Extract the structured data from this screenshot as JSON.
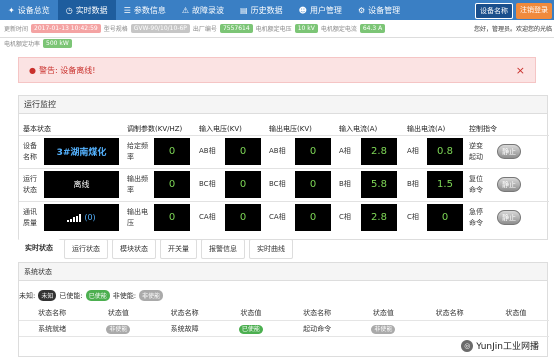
{
  "nav": {
    "tabs": [
      {
        "icon": "home-icon",
        "glyph": "✦",
        "label": "设备总览"
      },
      {
        "icon": "clock-icon",
        "glyph": "◷",
        "label": "实时数据"
      },
      {
        "icon": "list-icon",
        "glyph": "☰",
        "label": "参数信息"
      },
      {
        "icon": "warning-icon",
        "glyph": "⚠",
        "label": "故障录波"
      },
      {
        "icon": "file-icon",
        "glyph": "▤",
        "label": "历史数据"
      },
      {
        "icon": "user-icon",
        "glyph": "☻",
        "label": "用户管理"
      },
      {
        "icon": "gear-icon",
        "glyph": "⚙",
        "label": "设备管理"
      }
    ],
    "active_index": 1,
    "device_btn": "设备名称",
    "logout_btn": "注销登录"
  },
  "info": {
    "update_label": "更新时间",
    "update_value": "2017-01-13 10:42:59",
    "model_label": "型号规格",
    "model_value": "GVW-90/10/10-6P",
    "serial_label": "出厂编号",
    "serial_value": "7557614",
    "voltage_label": "电机额定电压",
    "voltage_value": "10 kV",
    "current_label": "电机额定电流",
    "current_value": "64.3 A",
    "power_label": "电机额定功率",
    "power_value": "500 kW",
    "welcome": "您好，管理员。欢迎您的光临"
  },
  "alert": {
    "text": "警告: 设备离线!"
  },
  "monitor": {
    "title": "运行监控",
    "headers": [
      "基本状态",
      "调制参数(KV/HZ)",
      "输入电压(KV)",
      "输出电压(KV)",
      "输入电流(A)",
      "输出电流(A)",
      "控制指令"
    ],
    "rows": [
      {
        "status_label": "设备\n名称",
        "status_value": "3#湖南煤化",
        "param_label": "给定频\n率",
        "param_value": "0",
        "in_v_label": "AB相",
        "in_v": "0",
        "out_v_label": "AB相",
        "out_v": "0",
        "in_a_label": "A相",
        "in_a": "2.8",
        "out_a_label": "A相",
        "out_a": "0.8",
        "cmd_label": "逆变\n起动",
        "cmd_btn": "静止"
      },
      {
        "status_label": "运行\n状态",
        "status_value": "离线",
        "param_label": "输出频\n率",
        "param_value": "0",
        "in_v_label": "BC相",
        "in_v": "0",
        "out_v_label": "BC相",
        "out_v": "0",
        "in_a_label": "B相",
        "in_a": "5.8",
        "out_a_label": "B相",
        "out_a": "1.5",
        "cmd_label": "复位\n命令",
        "cmd_btn": "静止"
      },
      {
        "status_label": "通讯\n质量",
        "status_value": "(0)",
        "param_label": "输出电\n压",
        "param_value": "0",
        "in_v_label": "CA相",
        "in_v": "0",
        "out_v_label": "CA相",
        "out_v": "0",
        "in_a_label": "C相",
        "in_a": "2.8",
        "out_a_label": "C相",
        "out_a": "0",
        "cmd_label": "急停\n命令",
        "cmd_btn": "静止"
      }
    ]
  },
  "tabs": [
    "实时状态",
    "运行状态",
    "模块状态",
    "开关量",
    "报警信息",
    "实时曲线"
  ],
  "system": {
    "title": "系统状态",
    "legend": {
      "unknown_label": "未知:",
      "unknown_badge": "未知",
      "enabled_label": "已使能:",
      "enabled_badge": "已使能",
      "disabled_label": "非使能:",
      "disabled_badge": "非使能"
    },
    "headers": [
      "状态名称",
      "状态值",
      "状态名称",
      "状态值",
      "状态名称",
      "状态值",
      "状态名称",
      "状态值"
    ],
    "row": {
      "n1": "系统就绪",
      "v1": "非使能",
      "n2": "系统故障",
      "v2": "已使能",
      "n3": "起动命令",
      "v3": "非使能",
      "n4": "",
      "v4": ""
    }
  },
  "watermark": {
    "circle": "◎",
    "text": "YunJin工业网播"
  }
}
